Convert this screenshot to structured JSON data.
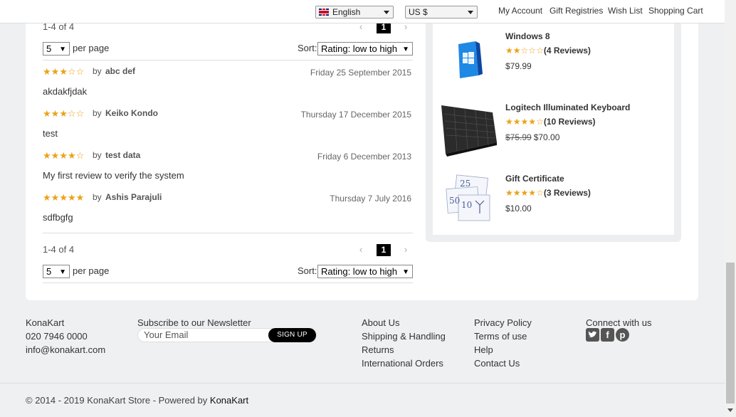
{
  "topbar": {
    "language": "English",
    "currency": "US $",
    "links": [
      "My Account",
      "Gift Registries",
      "Wish List",
      "Shopping Cart"
    ]
  },
  "reviews_block": {
    "count_text": "1-4 of 4",
    "current_page": "1",
    "prev_icon": "chevron-left-icon",
    "next_icon": "chevron-right-icon",
    "per_page_value": "5",
    "per_page_label": "per page",
    "sort_label": "Sort:",
    "sort_value": "Rating: low to high",
    "by_label": "by",
    "reviews": [
      {
        "rating": 3,
        "author": "abc def",
        "date": "Friday 25 September 2015",
        "text": "akdakfjdak"
      },
      {
        "rating": 3,
        "author": "Keiko Kondo",
        "date": "Thursday 17 December 2015",
        "text": "test"
      },
      {
        "rating": 4,
        "author": "test data",
        "date": "Friday 6 December 2013",
        "text": "My first review to verify the system"
      },
      {
        "rating": 5,
        "author": "Ashis Parajuli",
        "date": "Thursday 7 July 2016",
        "text": "sdfbgfg"
      }
    ]
  },
  "sidebar": {
    "products": [
      {
        "name": "Windows 8",
        "rating": 2,
        "reviews": "(4 Reviews)",
        "old_price": "",
        "price": "$79.99"
      },
      {
        "name": "Logitech Illuminated Keyboard",
        "rating": 4,
        "reviews": "(10 Reviews)",
        "old_price": "$75.99",
        "price": "$70.00"
      },
      {
        "name": "Gift Certificate",
        "rating": 4,
        "reviews": "(3 Reviews)",
        "old_price": "",
        "price": "$10.00"
      }
    ]
  },
  "footer": {
    "company": "KonaKart",
    "phone": "020 7946 0000",
    "email": "info@konakart.com",
    "newsletter_title": "Subscribe to our Newsletter",
    "newsletter_placeholder": "Your Email",
    "signup_label": "SIGN UP",
    "links_col1": [
      "About Us",
      "Shipping & Handling",
      "Returns",
      "International Orders"
    ],
    "links_col2": [
      "Privacy Policy",
      "Terms of use",
      "Help",
      "Contact Us"
    ],
    "connect_title": "Connect with us",
    "social_icons": [
      "twitter-icon",
      "facebook-icon",
      "pinterest-icon"
    ],
    "copyright_prefix": "© 2014 - 2019 KonaKart Store - Powered by ",
    "copyright_brand": "KonaKart"
  },
  "colors": {
    "star": "#e8a317",
    "page_bg": "#eef0f2",
    "pager_active_bg": "#000000"
  }
}
